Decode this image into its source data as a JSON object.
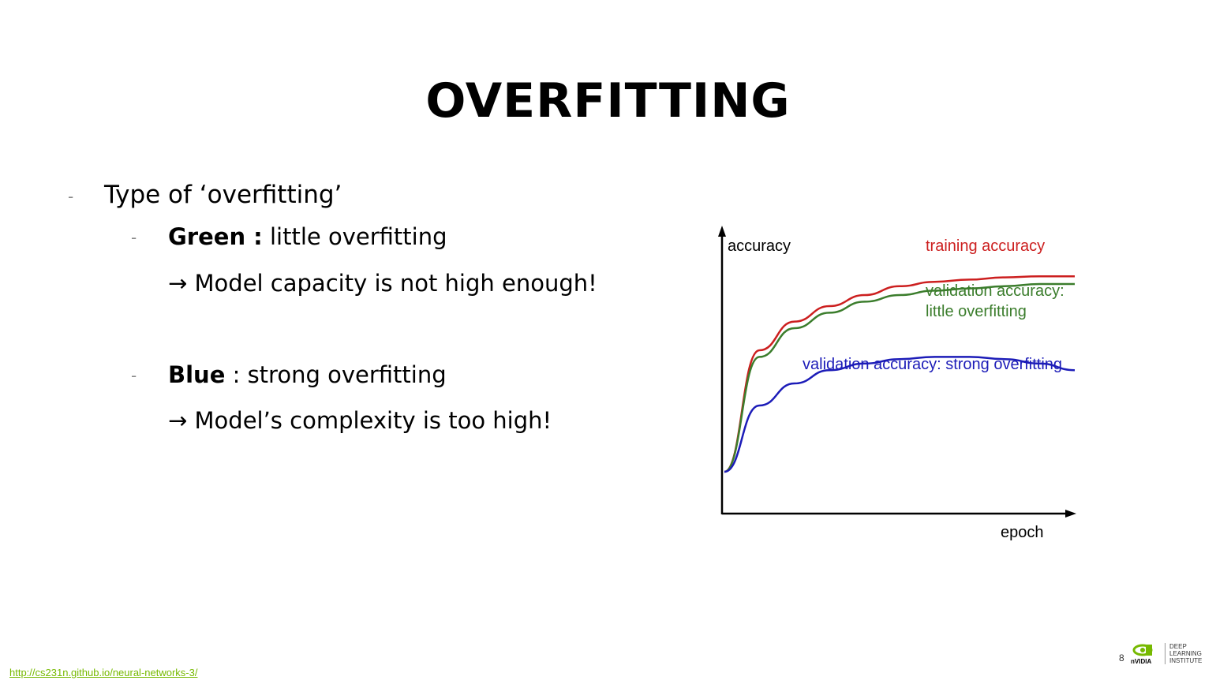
{
  "slide": {
    "title": "OVERFITTING",
    "bullets": {
      "main": "Type of ‘overfitting’",
      "green_label": "Green :",
      "green_text": " little overfitting",
      "green_note": "→ Model capacity is not high enough!",
      "blue_label": "Blue",
      "blue_text": " : strong overfitting",
      "blue_note": "→ Model’s complexity is too high!"
    },
    "footer": {
      "link": "http://cs231n.github.io/neural-networks-3/",
      "page_number": "8",
      "logo_text": "nVIDIA",
      "institute_lines": [
        "DEEP",
        "LEARNING",
        "INSTITUTE"
      ]
    }
  },
  "colors": {
    "training": "#cc1f1f",
    "little_overfit": "#3b7d2c",
    "strong_overfit": "#1c1cb8",
    "link": "#76b900"
  },
  "chart_data": {
    "type": "line",
    "xlabel": "epoch",
    "ylabel": "accuracy",
    "series": [
      {
        "name": "training accuracy",
        "x": [
          0,
          0.1,
          0.2,
          0.3,
          0.4,
          0.5,
          0.6,
          0.7,
          0.8,
          0.9,
          1.0
        ],
        "values": [
          0.0,
          0.55,
          0.68,
          0.75,
          0.8,
          0.84,
          0.86,
          0.87,
          0.88,
          0.885,
          0.885
        ]
      },
      {
        "name": "validation accuracy: little overfitting",
        "x": [
          0,
          0.1,
          0.2,
          0.3,
          0.4,
          0.5,
          0.6,
          0.7,
          0.8,
          0.9,
          1.0
        ],
        "values": [
          0.0,
          0.52,
          0.65,
          0.72,
          0.77,
          0.8,
          0.82,
          0.83,
          0.84,
          0.85,
          0.85
        ]
      },
      {
        "name": "validation accuracy: strong overfitting",
        "x": [
          0,
          0.1,
          0.2,
          0.3,
          0.4,
          0.5,
          0.6,
          0.7,
          0.8,
          0.9,
          1.0
        ],
        "values": [
          0.0,
          0.3,
          0.4,
          0.46,
          0.49,
          0.51,
          0.52,
          0.52,
          0.51,
          0.49,
          0.46
        ]
      }
    ],
    "labels": [
      "training accuracy",
      "validation accuracy:",
      "little overfitting",
      "validation accuracy: strong overfitting"
    ],
    "axes_ticks": false,
    "grid": false
  }
}
